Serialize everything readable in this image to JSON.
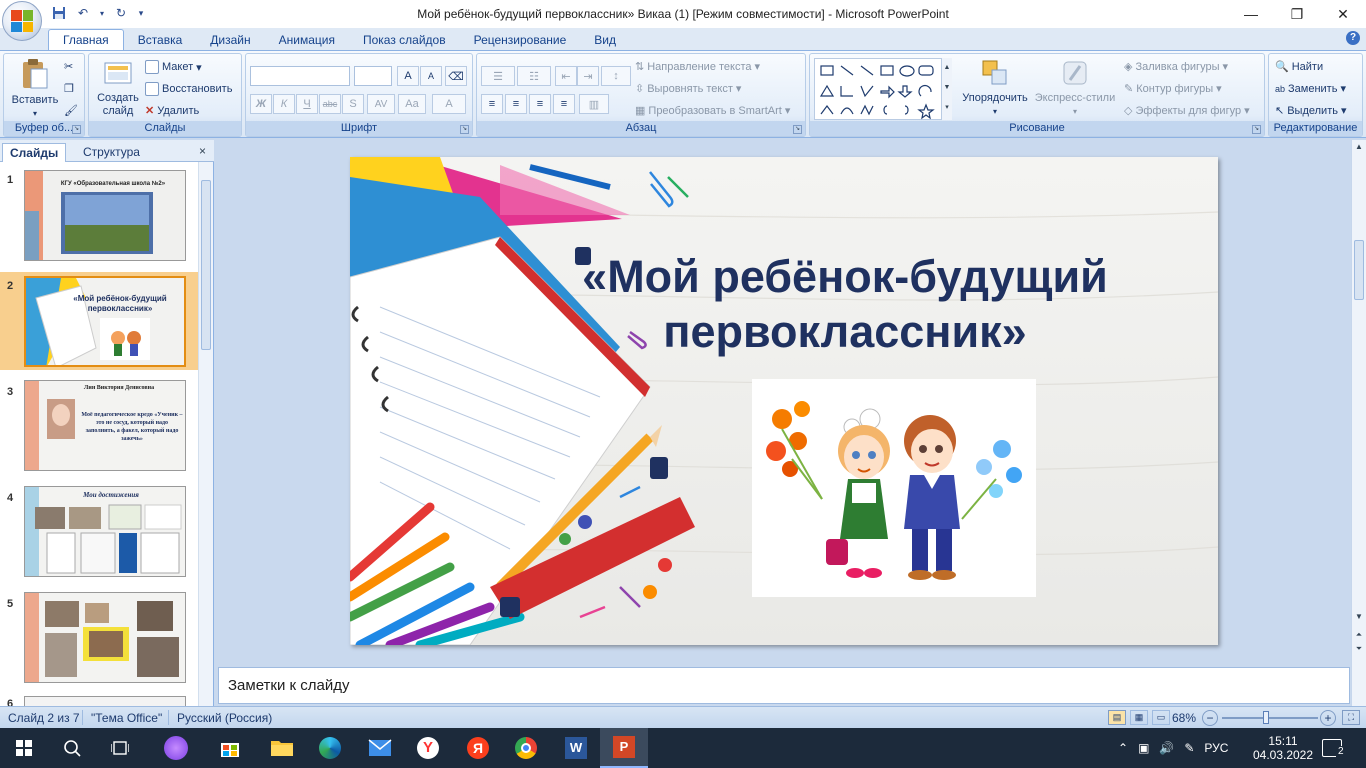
{
  "window": {
    "title": "Мой ребёнок-будущий первоклассник» Викаа (1) [Режим совместимости] - Microsoft PowerPoint",
    "controls": [
      "—",
      "❐",
      "✕"
    ]
  },
  "ribbon_tabs": [
    "Главная",
    "Вставка",
    "Дизайн",
    "Анимация",
    "Показ слайдов",
    "Рецензирование",
    "Вид"
  ],
  "ribbon": {
    "clipboard": {
      "label": "Буфер об...",
      "paste": "Вставить"
    },
    "slides": {
      "label": "Слайды",
      "new_slide": "Создать слайд",
      "layout": "Макет",
      "reset": "Восстановить",
      "delete": "Удалить"
    },
    "font": {
      "label": "Шрифт",
      "bold": "Ж",
      "italic": "К",
      "underline": "Ч",
      "strike": "abc",
      "shadow": "S",
      "spacing": "AV",
      "case": "Aa",
      "color": "A",
      "grow": "A",
      "shrink": "A"
    },
    "paragraph": {
      "label": "Абзац",
      "text_direction": "Направление текста",
      "align_text": "Выровнять текст",
      "smartart": "Преобразовать в SmartArt"
    },
    "drawing": {
      "label": "Рисование",
      "arrange": "Упорядочить",
      "quick_styles": "Экспресс-стили",
      "fill": "Заливка фигуры",
      "outline": "Контур фигуры",
      "effects": "Эффекты для фигур"
    },
    "editing": {
      "label": "Редактирование",
      "find": "Найти",
      "replace": "Заменить",
      "select": "Выделить"
    }
  },
  "panel": {
    "tab_slides": "Слайды",
    "tab_outline": "Структура",
    "close": "×",
    "thumbnails": [
      {
        "num": "1",
        "caption": "КГУ «Образовательная школа №2»"
      },
      {
        "num": "2",
        "caption": "«Мой ребёнок-будущий первоклассник»"
      },
      {
        "num": "3",
        "caption": "Лин Виктория Денисовна",
        "text": "Моё педагогическое кредо «Ученик – это не сосуд, который надо заполнить, а факел, который надо зажечь»"
      },
      {
        "num": "4",
        "caption": "Мои достижения"
      },
      {
        "num": "5",
        "caption": ""
      },
      {
        "num": "6",
        "caption": ""
      }
    ],
    "selected_index": 1
  },
  "slide": {
    "title_line1": "«Мой ребёнок-будущий",
    "title_line2": "первоклассник»"
  },
  "notes": {
    "placeholder": "Заметки к слайду"
  },
  "status": {
    "slide": "Слайд 2 из 7",
    "theme": "\"Тема Office\"",
    "language": "Русский (Россия)",
    "zoom": "68%",
    "zoom_level": 0.45
  },
  "taskbar": {
    "lang": "РУС",
    "time": "15:11",
    "date": "04.03.2022",
    "notifications": "2"
  },
  "colors": {
    "title": "#1f3160",
    "ribbon_text": "#15428b",
    "taskbar": "#1c2a3b"
  }
}
